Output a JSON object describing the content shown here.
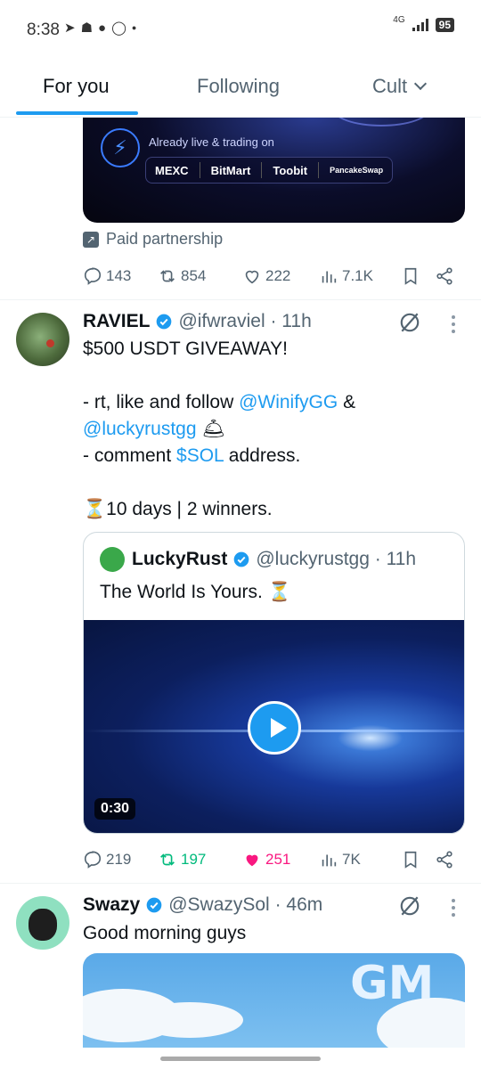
{
  "status_bar": {
    "time": "8:38",
    "network": "4G",
    "battery": "95",
    "notification_icons": [
      "telegram-icon",
      "snapchat-icon",
      "chat-icon",
      "whatsapp-icon",
      "dot-icon"
    ]
  },
  "tabs": [
    {
      "label": "For you",
      "active": true
    },
    {
      "label": "Following",
      "active": false
    },
    {
      "label": "Cult",
      "active": false
    }
  ],
  "promo_post": {
    "banner_text": "Already live & trading on",
    "exchanges": [
      "MEXC",
      "BitMart",
      "Toobit",
      "PancakeSwap"
    ],
    "paid_label": "Paid partnership",
    "actions": {
      "replies": "143",
      "reposts": "854",
      "likes": "222",
      "views": "7.1K"
    }
  },
  "tweet1": {
    "name": "RAVIEL",
    "handle": "@ifwraviel",
    "time": "11h",
    "line1": "$500 USDT GIVEAWAY!",
    "line2_pre": "- rt, like and follow ",
    "line2_link": "@WinifyGG",
    "line2_post": " &",
    "line3_link": "@luckyrustgg",
    "line3_emoji": "🛎",
    "line4_pre": "- comment ",
    "line4_link": "$SOL",
    "line4_post": " address.",
    "line5": "⏳10 days | 2 winners.",
    "quote": {
      "name": "LuckyRust",
      "handle": "@luckyrustgg",
      "time": "11h",
      "text": "The World Is Yours. ⏳",
      "video_duration": "0:30"
    },
    "actions": {
      "replies": "219",
      "reposts": "197",
      "likes": "251",
      "views": "7K"
    }
  },
  "tweet2": {
    "name": "Swazy",
    "handle": "@SwazySol",
    "time": "46m",
    "text": "Good morning guys",
    "image_text": "GM"
  },
  "colors": {
    "accent": "#1d9bf0",
    "repost_active": "#00ba7c",
    "like_active": "#f91880",
    "secondary_text": "#536471"
  }
}
